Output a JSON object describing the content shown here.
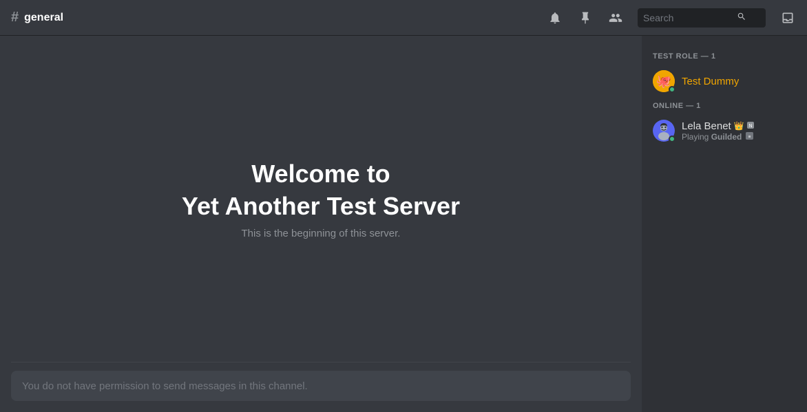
{
  "header": {
    "channel_icon": "#",
    "channel_name": "general",
    "search_placeholder": "Search"
  },
  "header_icons": {
    "bell": "🔔",
    "pin": "📌",
    "members": "👥",
    "inbox": "⬛"
  },
  "chat": {
    "welcome_line1": "Welcome to",
    "welcome_line2": "Yet Another Test Server",
    "welcome_subtitle": "This is the beginning of this server.",
    "no_permission": "You do not have permission to send messages in this channel."
  },
  "members_sidebar": {
    "role_group": {
      "label": "TEST ROLE — 1",
      "members": [
        {
          "name": "Test Dummy",
          "name_color": "#f0a500",
          "avatar_emoji": "🐙",
          "status": "online",
          "status_color": "#43b581"
        }
      ]
    },
    "online_group": {
      "label": "ONLINE — 1",
      "members": [
        {
          "name": "Lela Benet",
          "name_color": "#dcddde",
          "avatar_type": "image",
          "status": "online",
          "status_color": "#43b581",
          "has_crown": true,
          "has_nitro": true,
          "activity": "Playing",
          "activity_game": "Guilded"
        }
      ]
    }
  }
}
